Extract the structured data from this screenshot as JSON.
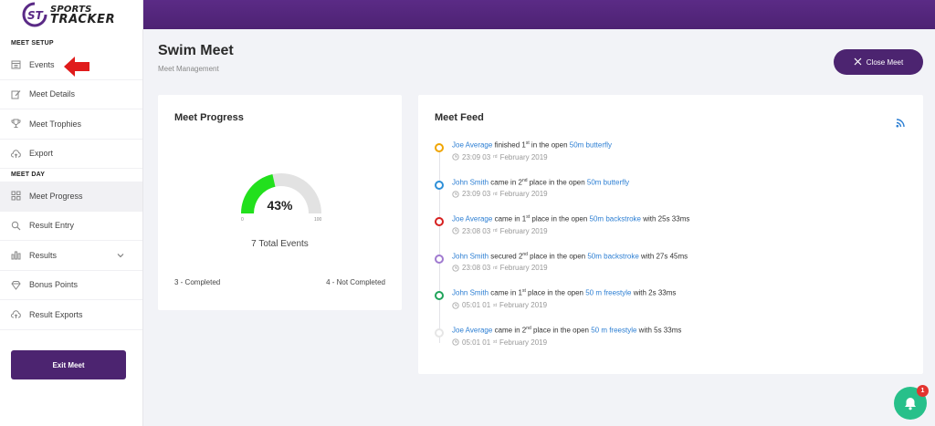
{
  "app": {
    "brand_line1": "SPORTS",
    "brand_line2": "TRACKER",
    "accent": "#4c2470"
  },
  "sidebar": {
    "sections": [
      {
        "label": "MEET SETUP",
        "items": [
          {
            "label": "Events",
            "icon": "calendar-icon"
          },
          {
            "label": "Meet Details",
            "icon": "edit-icon"
          },
          {
            "label": "Meet Trophies",
            "icon": "trophy-icon"
          },
          {
            "label": "Export",
            "icon": "cloud-upload-icon"
          }
        ]
      },
      {
        "label": "MEET DAY",
        "items": [
          {
            "label": "Meet Progress",
            "icon": "grid-icon",
            "active": true
          },
          {
            "label": "Result Entry",
            "icon": "search-icon"
          },
          {
            "label": "Results",
            "icon": "bar-chart-icon",
            "has_dropdown": true
          },
          {
            "label": "Bonus Points",
            "icon": "diamond-icon"
          },
          {
            "label": "Result Exports",
            "icon": "cloud-upload-icon"
          }
        ]
      }
    ],
    "exit_label": "Exit Meet"
  },
  "header": {
    "title": "Swim Meet",
    "subtitle": "Meet Management",
    "close_label": "Close Meet"
  },
  "progress": {
    "title": "Meet Progress",
    "percent": 43,
    "percent_label": "43%",
    "gauge_min": "0",
    "gauge_max": "100",
    "total_events": "7 Total Events",
    "completed": "3 - Completed",
    "not_completed": "4 - Not Completed",
    "gauge_color": "#22e01d"
  },
  "feed": {
    "title": "Meet Feed",
    "items": [
      {
        "color": "#f0a500",
        "name": "Joe Average",
        "pre": " finished 1",
        "ord": "st",
        "mid": " in the open ",
        "event": "50m butterfly",
        "post": "",
        "time": "23:09 03",
        "time_ord": "rd",
        "date": " February 2019"
      },
      {
        "color": "#2d8fd8",
        "name": "John Smith",
        "pre": " came in 2",
        "ord": "nd",
        "mid": " place in the open ",
        "event": "50m butterfly",
        "post": "",
        "time": "23:09 03",
        "time_ord": "rd",
        "date": " February 2019"
      },
      {
        "color": "#d61f1f",
        "name": "Joe Average",
        "pre": " came in 1",
        "ord": "st",
        "mid": " place in the open ",
        "event": "50m backstroke",
        "post": " with 25s 33ms",
        "time": "23:08 03",
        "time_ord": "rd",
        "date": " February 2019"
      },
      {
        "color": "#a07ad0",
        "name": "John Smith",
        "pre": " secured 2",
        "ord": "nd",
        "mid": " place in the open ",
        "event": "50m backstroke",
        "post": " with 27s 45ms",
        "time": "23:08 03",
        "time_ord": "rd",
        "date": " February 2019"
      },
      {
        "color": "#1fa35a",
        "name": "John Smith",
        "pre": " came in 1",
        "ord": "st",
        "mid": " place in the open ",
        "event": "50 m freestyle",
        "post": " with 2s 33ms",
        "time": "05:01 01",
        "time_ord": "st",
        "date": " February 2019"
      },
      {
        "color": "#e6e6e6",
        "name": "Joe Average",
        "pre": " came in 2",
        "ord": "nd",
        "mid": " place in the open ",
        "event": "50 m freestyle",
        "post": " with 5s 33ms",
        "time": "05:01 01",
        "time_ord": "st",
        "date": " February 2019"
      }
    ]
  },
  "notifications": {
    "count": "1"
  }
}
